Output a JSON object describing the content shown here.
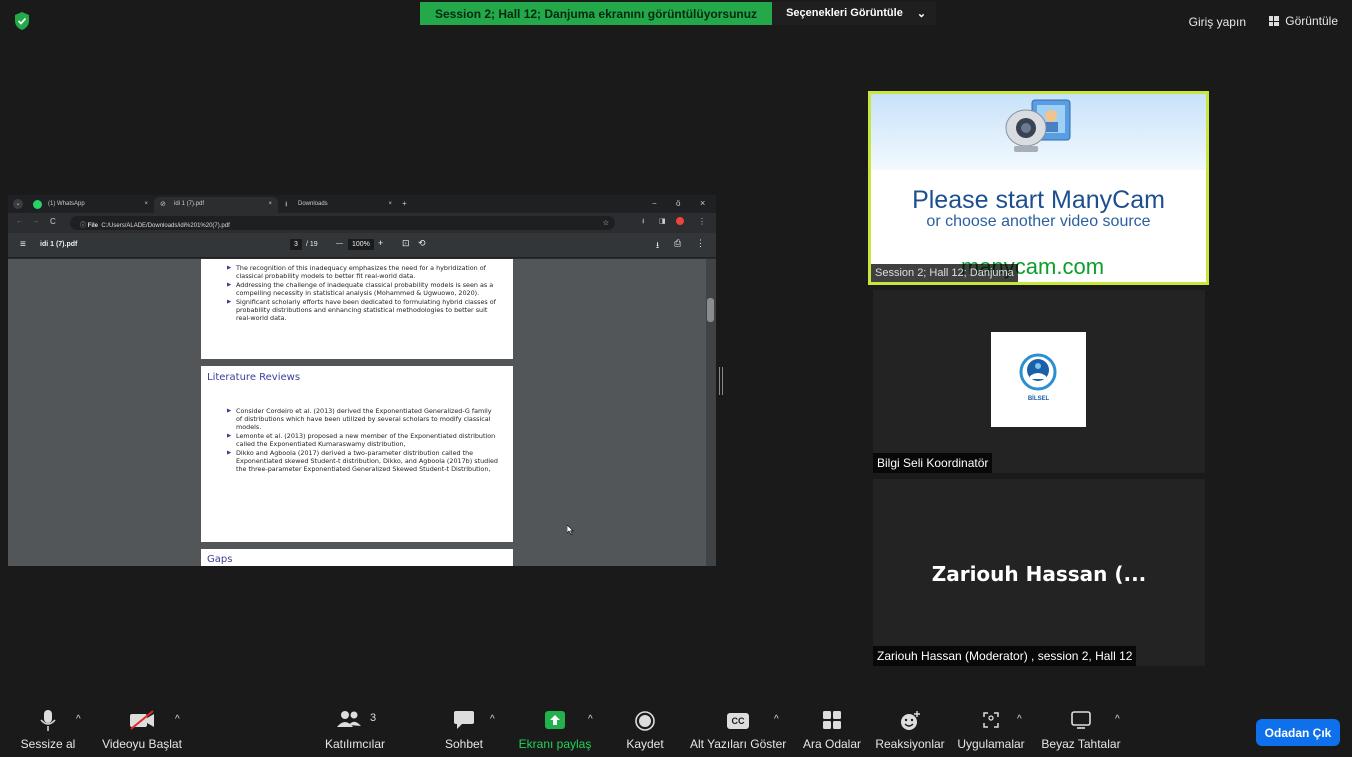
{
  "top_bar": {
    "share_status": "Session 2; Hall 12; Danjuma ekranını görüntülüyorsunuz",
    "view_options": "Seçenekleri Görüntüle",
    "view_options_caret": "⌄",
    "sign_in": "Giriş yapın",
    "view": "Görüntüle"
  },
  "browser": {
    "tabs": [
      {
        "label": "(1) WhatsApp",
        "close": "×"
      },
      {
        "label": "idi 1 (7).pdf",
        "close": "×"
      },
      {
        "label": "Downloads",
        "close": "×"
      }
    ],
    "new_tab": "+",
    "window_controls": {
      "min": "−",
      "restore": "ӧ",
      "close": "×"
    },
    "url_chip": "File",
    "url": "C:/Users/ALADE/Downloads/idi%201%20(7).pdf",
    "pdf_title": "idi 1 (7).pdf",
    "page_current": "3",
    "page_total": "/ 19",
    "zoom": "100%",
    "zoom_out": "—",
    "zoom_in": "+"
  },
  "pdf": {
    "page1_bullets": [
      "The recognition of this inadequacy emphasizes the need for a hybridization of classical probability models to better fit real-world data.",
      "Addressing the challenge of inadequate classical probability models is seen as a compelling necessity in statistical analysis (Mohammed & Ugwuowo, 2020).",
      "Significant scholarly efforts have been dedicated to formulating hybrid classes of probability distributions and enhancing statistical methodologies to better suit real-world data."
    ],
    "page2_title": "Literature Reviews",
    "page2_bullets": [
      "Consider Cordeiro et al. (2013) derived the Exponentiated Generalized-G family of distributions which have been utilized by several scholars to modify classical models.",
      "Lemonte et al. (2013) proposed a new member of the Exponentiated distribution called the Exponentiated Kumaraswamy distribution,",
      "Dikko and Agboola (2017) derived a two-parameter distribution called the Exponentiated skewed Student-t distribution, Dikko, and Agboola (2017b) studied the three-parameter Exponentiated Generalized Skewed Student-t Distribution,"
    ],
    "page3_title": "Gaps"
  },
  "tiles": {
    "manycam_line1": "Please start ManyCam",
    "manycam_line2": "or choose another video source",
    "manycam_url": "manycam.com",
    "tile1_name": "Session 2; Hall 12; Danjuma",
    "tile2_logo_text": "BİLSEL",
    "tile2_name": "Bilgi Seli Koordinatör",
    "tile3_big": "Zariouh Hassan (...",
    "tile3_name": "Zariouh Hassan (Moderator) , session 2, Hall 12"
  },
  "toolbar": {
    "mute": "Sessize al",
    "video": "Videoyu Başlat",
    "participants": "Katılımcılar",
    "participants_count": "3",
    "chat": "Sohbet",
    "share": "Ekranı paylaş",
    "record": "Kaydet",
    "captions": "Alt Yazıları Göster",
    "captions_icon_text": "CC",
    "breakout": "Ara Odalar",
    "reactions": "Reaksiyonlar",
    "apps": "Uygulamalar",
    "whiteboard": "Beyaz Tahtalar",
    "caret": "^",
    "leave": "Odadan Çık"
  },
  "colors": {
    "share_green": "#23a84a",
    "speaker_border": "#c8e63c",
    "leave_blue": "#0e71eb",
    "pdf_heading": "#3c3c99"
  }
}
